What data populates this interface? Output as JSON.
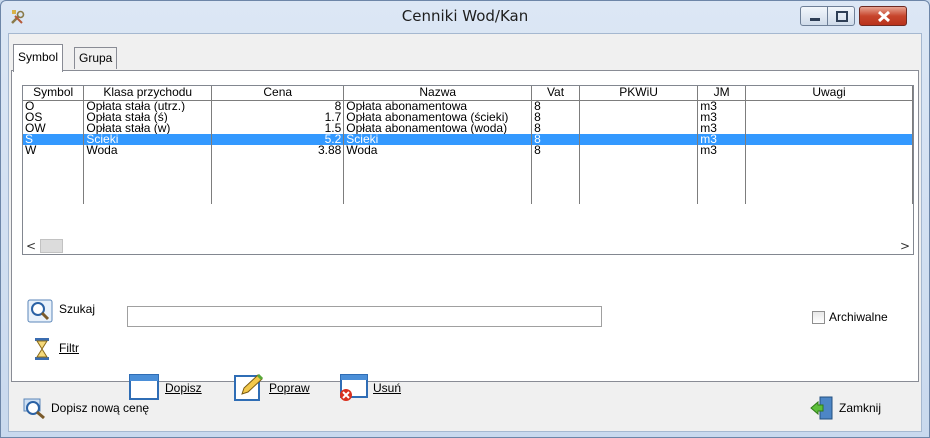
{
  "window": {
    "title": "Cenniki Wod/Kan",
    "icon": "tools-app-icon",
    "controls": [
      "minimize-icon",
      "maximize-icon",
      "close-icon"
    ]
  },
  "tabs": [
    {
      "label": "Symbol",
      "active": true
    },
    {
      "label": "Grupa",
      "active": false
    }
  ],
  "grid": {
    "columns": [
      "Symbol",
      "Klasa przychodu",
      "Cena",
      "Nazwa",
      "Vat",
      "PKWiU",
      "JM",
      "Uwagi"
    ],
    "rows": [
      {
        "symbol": "O",
        "klasa": "Opłata stała (utrz.)",
        "cena": "8",
        "nazwa": "Opłata abonamentowa",
        "vat": "8",
        "pkwiu": "",
        "jm": "m3",
        "uwagi": "",
        "selected": false
      },
      {
        "symbol": "OS",
        "klasa": "Opłata stała (ś)",
        "cena": "1.7",
        "nazwa": "Opłata abonamentowa (ścieki)",
        "vat": "8",
        "pkwiu": "",
        "jm": "m3",
        "uwagi": "",
        "selected": false
      },
      {
        "symbol": "OW",
        "klasa": "Opłata stała (w)",
        "cena": "1.5",
        "nazwa": "Opłata abonamentowa (woda)",
        "vat": "8",
        "pkwiu": "",
        "jm": "m3",
        "uwagi": "",
        "selected": false
      },
      {
        "symbol": "S",
        "klasa": "Ścieki",
        "cena": "5.2",
        "nazwa": "Ścieki",
        "vat": "8",
        "pkwiu": "",
        "jm": "m3",
        "uwagi": "",
        "selected": true
      },
      {
        "symbol": "W",
        "klasa": "Woda",
        "cena": "3.88",
        "nazwa": "Woda",
        "vat": "8",
        "pkwiu": "",
        "jm": "m3",
        "uwagi": "",
        "selected": false
      }
    ],
    "scroll_left": "<",
    "scroll_right": ">"
  },
  "search": {
    "label": "Szukaj",
    "value": "",
    "icon": "magnifier-icon"
  },
  "filter": {
    "label": "Filtr",
    "icon": "hourglass-icon"
  },
  "archive": {
    "label": "Archiwalne",
    "checked": false
  },
  "actions": {
    "add": {
      "label": "Dopisz",
      "icon": "window-icon"
    },
    "edit": {
      "label": "Popraw",
      "icon": "pencil-icon"
    },
    "delete": {
      "label": "Usuń",
      "icon": "delete-icon"
    }
  },
  "footer": {
    "new_price": {
      "label": "Dopisz nową cenę",
      "icon": "search-add-icon"
    },
    "close": {
      "label": "Zamknij",
      "icon": "exit-door-icon"
    }
  },
  "colors": {
    "selection": "#3399ff",
    "title_bg": "#dce7f5",
    "close_red": "#c7452c"
  }
}
